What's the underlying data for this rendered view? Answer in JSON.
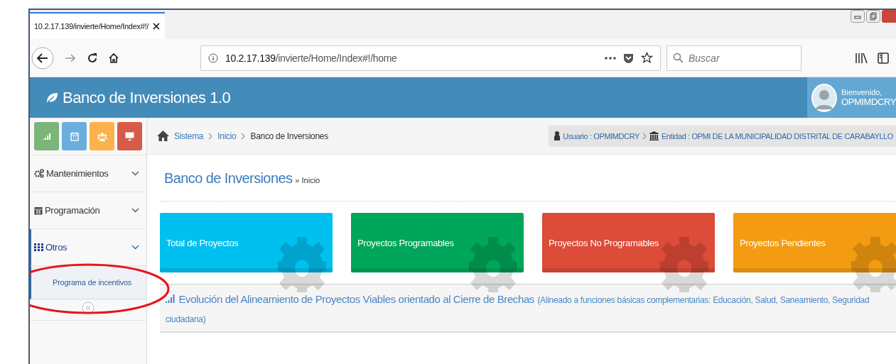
{
  "browser": {
    "tab_title": "10.2.17.139/invierte/Home/Index#!/",
    "address_host": "10.2.17.139",
    "address_path": "/invierte/Home/Index#!/home",
    "search": {
      "placeholder": "Buscar"
    }
  },
  "header": {
    "title": "Banco de Inversiones 1.0",
    "greeting": "Bienvenido,",
    "username": "OPMIMDCRY"
  },
  "shortcuts": [
    {
      "kind": "chart",
      "color": "#7cb57a"
    },
    {
      "kind": "calendar",
      "color": "#6aaede"
    },
    {
      "kind": "users",
      "color": "#fcb24b"
    },
    {
      "kind": "monitor",
      "color": "#d65b49"
    }
  ],
  "menu": [
    {
      "label": "Mantenimientos",
      "selected": false,
      "expanded": false
    },
    {
      "label": "Programación",
      "selected": false,
      "expanded": false
    },
    {
      "label": "Otros",
      "selected": true,
      "expanded": true,
      "children": [
        {
          "label": "Programa de incentivos"
        }
      ]
    }
  ],
  "breadcrumb": [
    "Sistema",
    "Inicio",
    "Banco de Inversiones"
  ],
  "user_info": {
    "user": "Usuario : OPMIMDCRY",
    "entity": "Entidad : OPMI DE LA MUNICIPALIDAD DISTRITAL DE CARABAYLLO"
  },
  "page": {
    "title": "Banco de Inversiones",
    "subtitle": "» Inicio"
  },
  "cards": [
    {
      "label": "Total de Proyectos",
      "color": "#00c0ef"
    },
    {
      "label": "Proyectos Programables",
      "color": "#00a65a"
    },
    {
      "label": "Proyectos No Programables",
      "color": "#dd4b39"
    },
    {
      "label": "Proyectos Pendientes",
      "color": "#f39c12"
    }
  ],
  "panel": {
    "title": "Evolución del Alineamiento de Proyectos Viables orientado al Cierre de Brechas",
    "note": "(Alineado a funciones básicas complementarias: Educación, Salud, Saneamiento, Seguridad ciudadana)"
  }
}
